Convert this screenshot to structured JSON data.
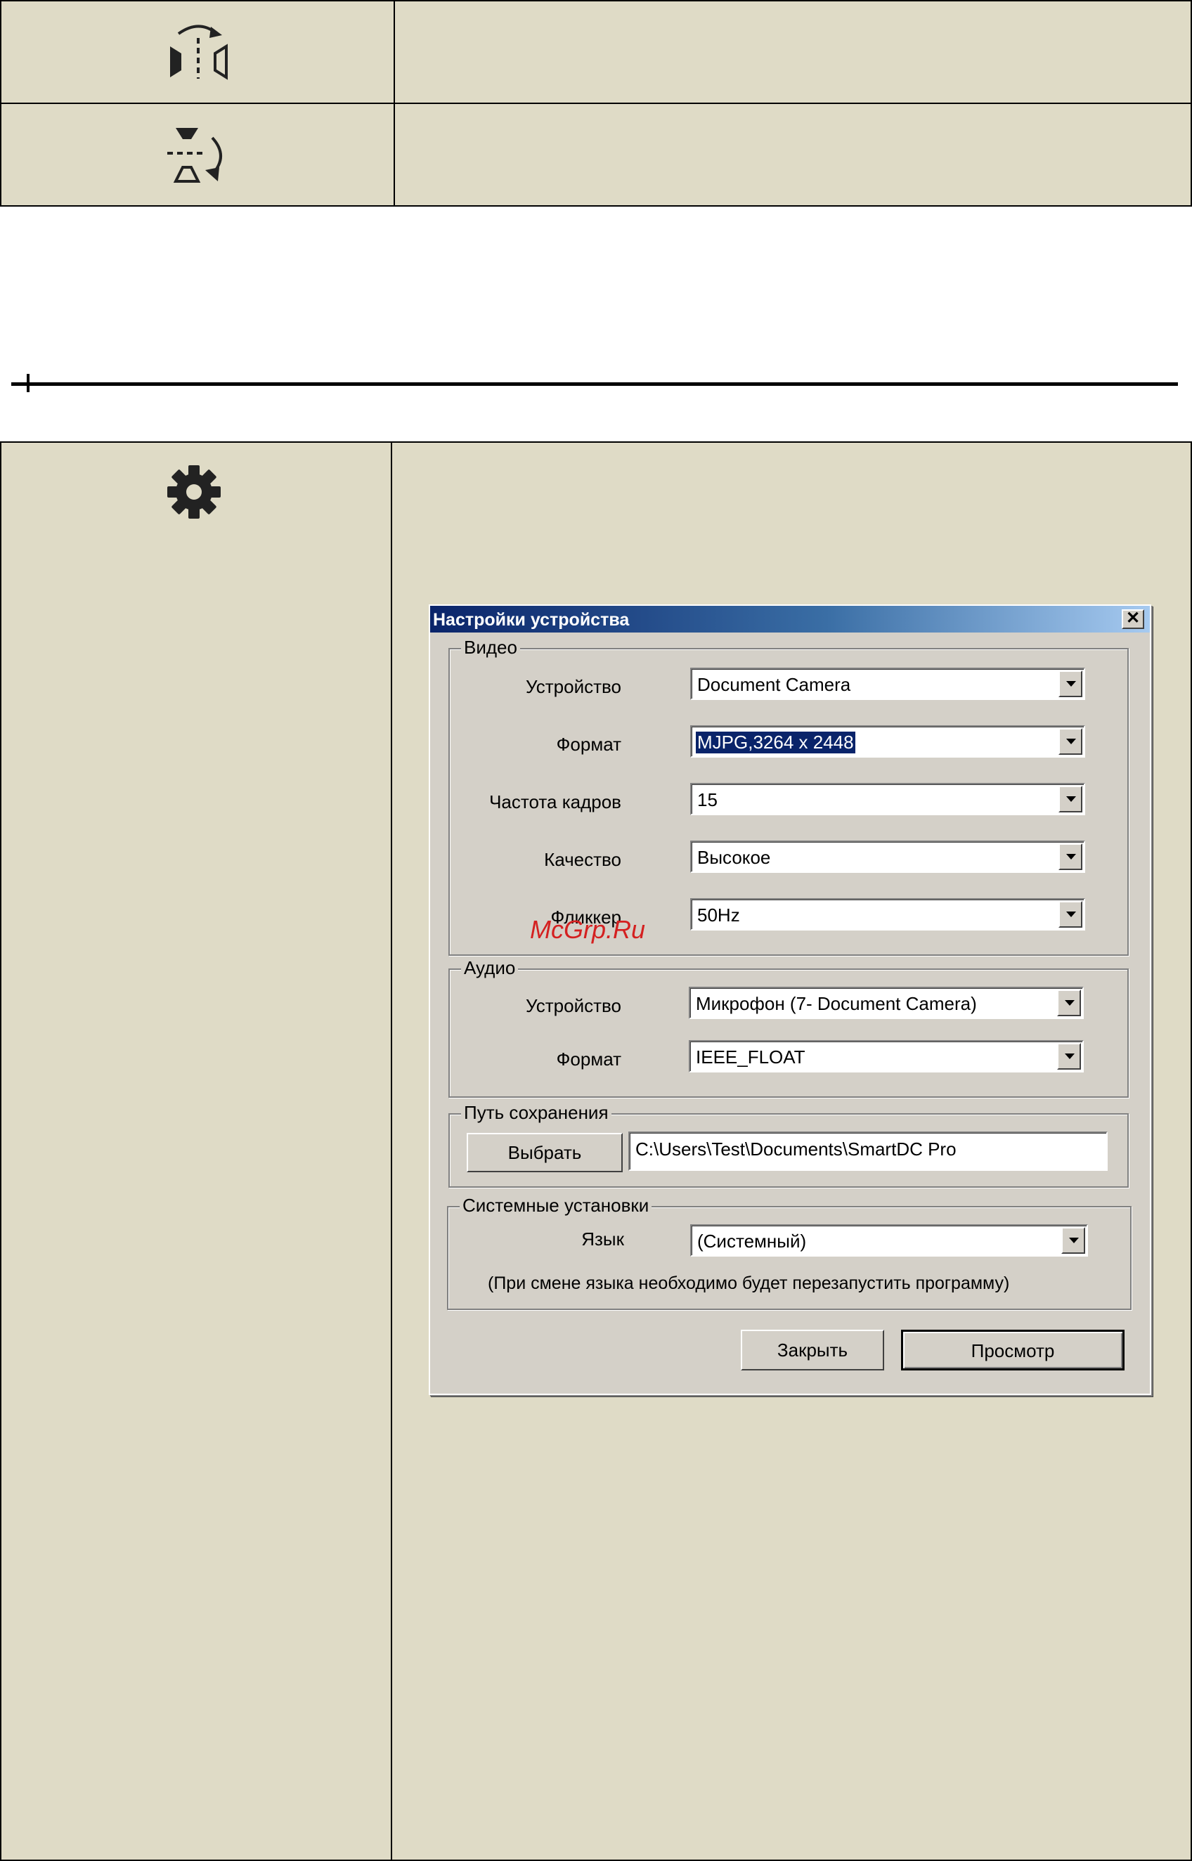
{
  "icons": {
    "row1": "flip-horizontal-icon",
    "row2": "flip-vertical-icon",
    "row3": "gear-icon"
  },
  "dialog": {
    "title": "Настройки устройства",
    "close_label": "✕",
    "video": {
      "legend": "Видео",
      "device_label": "Устройство",
      "device_value": "Document Camera",
      "format_label": "Формат",
      "format_value": "MJPG,3264 x 2448",
      "fps_label": "Частота кадров",
      "fps_value": "15",
      "quality_label": "Качество",
      "quality_value": "Высокое",
      "flicker_label": "Фликкер",
      "flicker_value": "50Hz"
    },
    "audio": {
      "legend": "Аудио",
      "device_label": "Устройство",
      "device_value": "Микрофон (7- Document Camera)",
      "format_label": "Формат",
      "format_value": "IEEE_FLOAT"
    },
    "save_path": {
      "legend": "Путь сохранения",
      "browse_label": "Выбрать",
      "path_value": "C:\\Users\\Test\\Documents\\SmartDC Pro"
    },
    "system": {
      "legend": "Системные установки",
      "language_label": "Язык",
      "language_value": "(Системный)",
      "note": "(При смене языка необходимо будет перезапустить программу)"
    },
    "close_button": "Закрыть",
    "preview_button": "Просмотр"
  },
  "watermark": "McGrp.Ru",
  "colors": {
    "cell_bg": "#dfdbc6",
    "dialog_bg": "#d4d0c8",
    "titlebar": "#0a246a",
    "watermark": "#d42020"
  }
}
